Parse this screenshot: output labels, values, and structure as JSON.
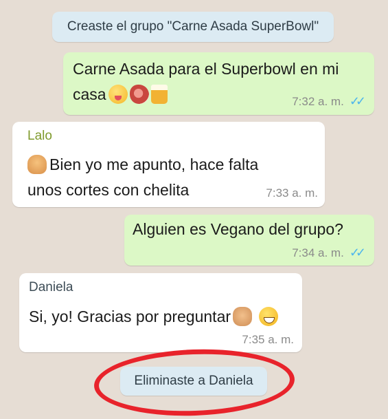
{
  "chat": {
    "created_notice": "Creaste el grupo \"Carne Asada SuperBowl\"",
    "messages": [
      {
        "direction": "outgoing",
        "lines": [
          "Carne Asada para el Superbowl en mi",
          "casa"
        ],
        "emojis": [
          "face-savoring-food-emoji",
          "cut-of-meat-emoji",
          "beer-mug-emoji"
        ],
        "time": "7:32 a. m.",
        "status": "read"
      },
      {
        "direction": "incoming",
        "sender": "Lalo",
        "sender_color": "#7f9a2c",
        "lines": [
          "Bien yo me apunto, hace falta",
          "unos cortes con chelita"
        ],
        "emojis": [
          "thumbs-up-emoji"
        ],
        "time": "7:33 a. m."
      },
      {
        "direction": "outgoing",
        "lines": [
          "Alguien es Vegano del grupo?"
        ],
        "time": "7:34 a. m.",
        "status": "read"
      },
      {
        "direction": "incoming",
        "sender": "Daniela",
        "sender_color": "#3d4c56",
        "lines": [
          "Si, yo! Gracias por preguntar"
        ],
        "emojis": [
          "clapping-hands-emoji",
          "grinning-face-emoji"
        ],
        "time": "7:35 a. m."
      }
    ],
    "removed_notice": "Eliminaste a Daniela"
  },
  "colors": {
    "background": "#e6ddd4",
    "outgoing_bubble": "#dcf8c6",
    "incoming_bubble": "#ffffff",
    "system_pill": "#dcebf3",
    "read_ticks": "#4fb6ec",
    "highlight_ring": "#e8232b"
  }
}
